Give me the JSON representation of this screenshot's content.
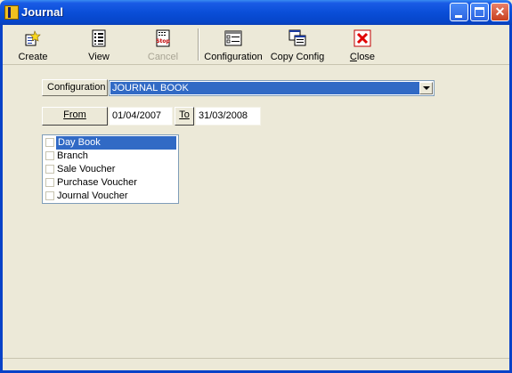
{
  "window": {
    "title": "Journal"
  },
  "toolbar": {
    "create": "Create",
    "view": "View",
    "cancel": "Cancel",
    "configuration": "Configuration",
    "copy_config": "Copy Config",
    "close": "Close"
  },
  "form": {
    "configuration_label": "Configuration",
    "configuration_value": "JOURNAL BOOK",
    "from_label": "From",
    "from_date": "01/04/2007",
    "to_label": "To",
    "to_date": "31/03/2008"
  },
  "list": {
    "items": [
      "Day Book",
      "Branch",
      "Sale Voucher",
      "Purchase Voucher",
      "Journal Voucher"
    ],
    "selected": "Day Book"
  },
  "icons": {
    "create": "create-icon",
    "view": "view-icon",
    "cancel": "stop-icon",
    "configuration": "configuration-icon",
    "copy_config": "copy-config-icon",
    "close": "close-red-x-icon"
  },
  "colors": {
    "titlebar": "#0a4ed8",
    "selection": "#316ac5",
    "face": "#ece9d8"
  }
}
